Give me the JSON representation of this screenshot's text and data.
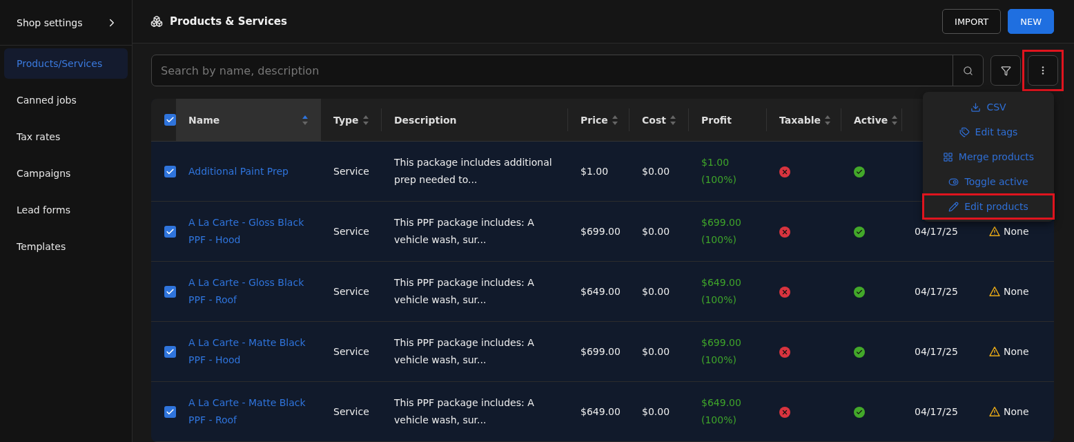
{
  "sidebar": {
    "title": "Shop settings",
    "items": [
      {
        "label": "Products/Services",
        "selected": true
      },
      {
        "label": "Canned jobs",
        "selected": false
      },
      {
        "label": "Tax rates",
        "selected": false
      },
      {
        "label": "Campaigns",
        "selected": false
      },
      {
        "label": "Lead forms",
        "selected": false
      },
      {
        "label": "Templates",
        "selected": false
      }
    ]
  },
  "header": {
    "title": "Products & Services",
    "buttons": [
      {
        "label": "IMPORT",
        "kind": "outline"
      },
      {
        "label": "NEW",
        "kind": "primary"
      }
    ]
  },
  "search": {
    "placeholder": "Search by name, description"
  },
  "more_button": {
    "highlighted": true
  },
  "menu": {
    "items": [
      {
        "label": "CSV",
        "highlighted": false
      },
      {
        "label": "Edit tags",
        "highlighted": false
      },
      {
        "label": "Merge products",
        "highlighted": false
      },
      {
        "label": "Toggle active",
        "highlighted": false
      },
      {
        "label": "Edit products",
        "highlighted": true
      }
    ]
  },
  "table": {
    "all_checked": true,
    "columns": [
      {
        "label": "Name",
        "sortable": true,
        "sorted": true
      },
      {
        "label": "Type",
        "sortable": true,
        "sorted": false
      },
      {
        "label": "Description",
        "sortable": false,
        "sorted": false
      },
      {
        "label": "Price",
        "sortable": true,
        "sorted": false
      },
      {
        "label": "Cost",
        "sortable": true,
        "sorted": false
      },
      {
        "label": "Profit",
        "sortable": false,
        "sorted": false
      },
      {
        "label": "Taxable",
        "sortable": true,
        "sorted": false
      },
      {
        "label": "Active",
        "sortable": true,
        "sorted": false
      }
    ],
    "rows": [
      {
        "checked": true,
        "name": "Additional Paint Prep",
        "type": "Service",
        "description": "This package includes additional prep needed to...",
        "price": "$1.00",
        "cost": "$0.00",
        "profit": "$1.00",
        "profit_pct": "(100%)",
        "taxable": false,
        "active": true
      },
      {
        "checked": true,
        "name": "A La Carte - Gloss Black PPF - Hood",
        "type": "Service",
        "description": "This PPF package includes: A vehicle wash, sur...",
        "price": "$699.00",
        "cost": "$0.00",
        "profit": "$699.00",
        "profit_pct": "(100%)",
        "taxable": false,
        "active": true,
        "date": "04/17/25",
        "warning": "None"
      },
      {
        "checked": true,
        "name": "A La Carte - Gloss Black PPF - Roof",
        "type": "Service",
        "description": "This PPF package includes: A vehicle wash, sur...",
        "price": "$649.00",
        "cost": "$0.00",
        "profit": "$649.00",
        "profit_pct": "(100%)",
        "taxable": false,
        "active": true,
        "date": "04/17/25",
        "warning": "None"
      },
      {
        "checked": true,
        "name": "A La Carte - Matte Black PPF - Hood",
        "type": "Service",
        "description": "This PPF package includes: A vehicle wash, sur...",
        "price": "$699.00",
        "cost": "$0.00",
        "profit": "$699.00",
        "profit_pct": "(100%)",
        "taxable": false,
        "active": true,
        "date": "04/17/25",
        "warning": "None"
      },
      {
        "checked": true,
        "name": "A La Carte - Matte Black PPF - Roof",
        "type": "Service",
        "description": "This PPF package includes: A vehicle wash, sur...",
        "price": "$649.00",
        "cost": "$0.00",
        "profit": "$649.00",
        "profit_pct": "(100%)",
        "taxable": false,
        "active": true,
        "date": "04/17/25",
        "warning": "None"
      }
    ]
  }
}
